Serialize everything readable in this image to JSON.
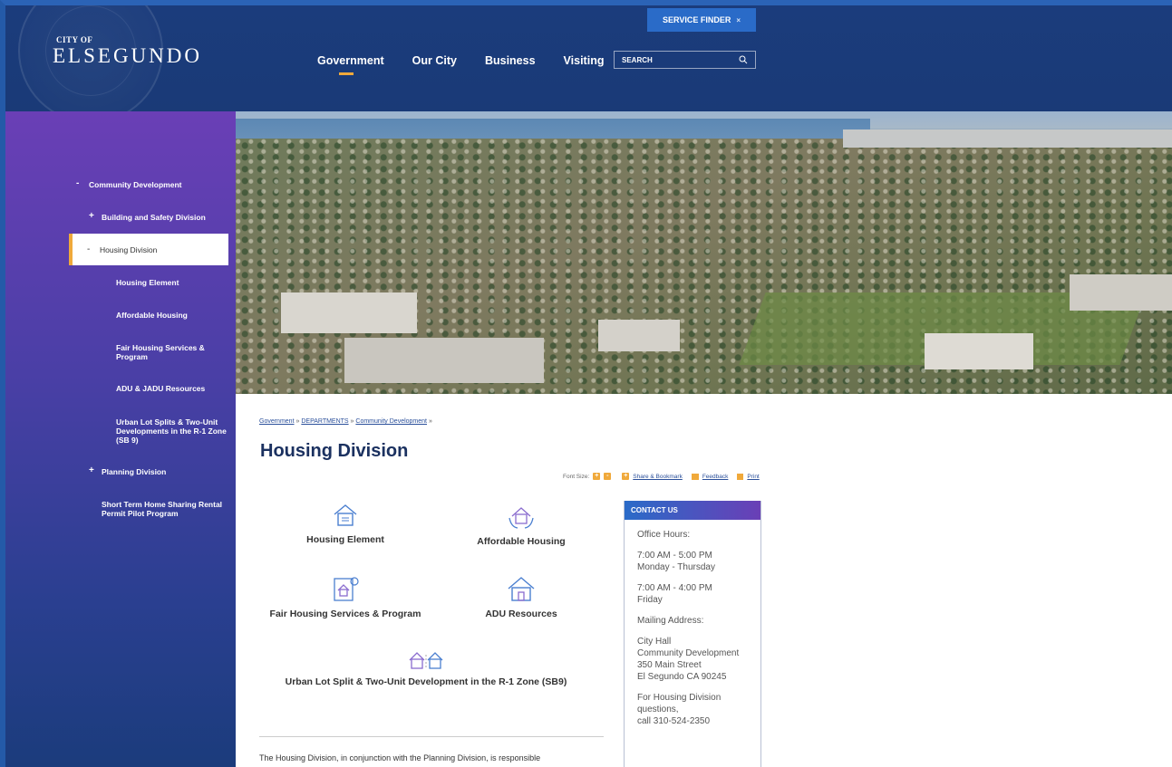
{
  "header": {
    "logo_small": "CITY OF",
    "logo_big": "ELSEGUNDO",
    "service_finder": "SERVICE FINDER",
    "service_finder_close": "×",
    "search_placeholder": "SEARCH",
    "nav": [
      "Government",
      "Our City",
      "Business",
      "Visiting"
    ],
    "active_nav": "Government"
  },
  "sidebar": {
    "items": [
      {
        "sym": "-",
        "label": "Community Development"
      },
      {
        "sym": "+",
        "label": "Building and Safety Division"
      },
      {
        "sym": "-",
        "label": "Housing Division",
        "active": true
      },
      {
        "sym": "",
        "label": "Housing Element"
      },
      {
        "sym": "",
        "label": "Affordable Housing"
      },
      {
        "sym": "",
        "label": "Fair Housing Services & Program"
      },
      {
        "sym": "",
        "label": "ADU & JADU Resources"
      },
      {
        "sym": "",
        "label": "Urban Lot Splits & Two-Unit Developments in the R-1 Zone (SB 9)"
      },
      {
        "sym": "+",
        "label": "Planning Division"
      },
      {
        "sym": "",
        "label": "Short Term Home Sharing Rental Permit Pilot Program"
      }
    ]
  },
  "breadcrumb": [
    "Government",
    "DEPARTMENTS",
    "Community Development"
  ],
  "breadcrumb_sep": "»",
  "page_title": "Housing Division",
  "tools": {
    "font_size": "Font Size:",
    "plus": "+",
    "minus": "-",
    "share": "Share & Bookmark",
    "feedback": "Feedback",
    "print": "Print"
  },
  "tiles": [
    {
      "label": "Housing Element"
    },
    {
      "label": "Affordable Housing"
    },
    {
      "label": "Fair Housing Services & Program"
    },
    {
      "label": "ADU Resources"
    },
    {
      "label": "Urban Lot Split & Two-Unit Development in the R-1 Zone (SB9)"
    }
  ],
  "intro": "The Housing Division, in conjunction with the Planning Division, is responsible",
  "contact": {
    "title": "CONTACT US",
    "office_hours_label": "Office Hours:",
    "hours1": "7:00 AM - 5:00 PM\nMonday - Thursday",
    "hours2": "7:00 AM - 4:00 PM\nFriday",
    "mailing_label": "Mailing Address:",
    "address": "City Hall\nCommunity Development\n350 Main Street\nEl Segundo CA 90245",
    "questions": "For Housing Division\nquestions,\ncall 310-524-2350"
  },
  "colors": {
    "accent": "#f0a93b",
    "brand_blue": "#1b3c7c",
    "sidebar_purple": "#6a3fb6",
    "link": "#2a4f9a"
  }
}
